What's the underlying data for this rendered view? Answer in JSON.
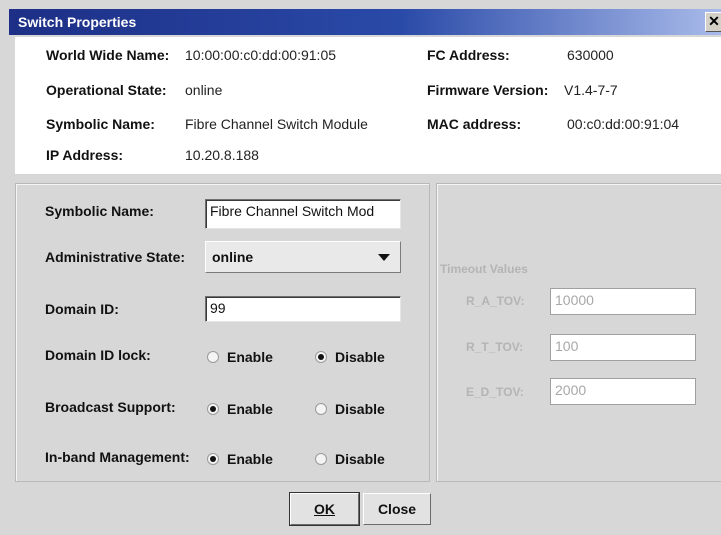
{
  "window": {
    "title": "Switch Properties",
    "close_glyph": "✕"
  },
  "info": {
    "wwn_label": "World Wide Name:",
    "wwn_value": "10:00:00:c0:dd:00:91:05",
    "op_state_label": "Operational State:",
    "op_state_value": "online",
    "symbolic_label": "Symbolic Name:",
    "symbolic_value": "Fibre Channel Switch Module",
    "ip_label": "IP Address:",
    "ip_value": "10.20.8.188",
    "fc_label": "FC Address:",
    "fc_value": "630000",
    "fw_label": "Firmware Version:",
    "fw_value": "V1.4-7-7",
    "mac_label": "MAC address:",
    "mac_value": "00:c0:dd:00:91:04"
  },
  "form": {
    "symbolic_label": "Symbolic Name:",
    "symbolic_value": "Fibre Channel Switch Mod",
    "admin_label": "Administrative State:",
    "admin_value": "online",
    "domain_label": "Domain ID:",
    "domain_value": "99",
    "domain_lock_label": "Domain ID lock:",
    "broadcast_label": "Broadcast Support:",
    "inband_label": "In-band Management:",
    "enable": "Enable",
    "disable": "Disable",
    "domain_lock_selected": "Disable",
    "broadcast_selected": "Enable",
    "inband_selected": "Enable"
  },
  "timeout": {
    "title": "Timeout Values",
    "ra_label": "R_A_TOV:",
    "ra_value": "10000",
    "rt_label": "R_T_TOV:",
    "rt_value": "100",
    "ed_label": "E_D_TOV:",
    "ed_value": "2000"
  },
  "buttons": {
    "ok": "OK",
    "close": "Close"
  }
}
